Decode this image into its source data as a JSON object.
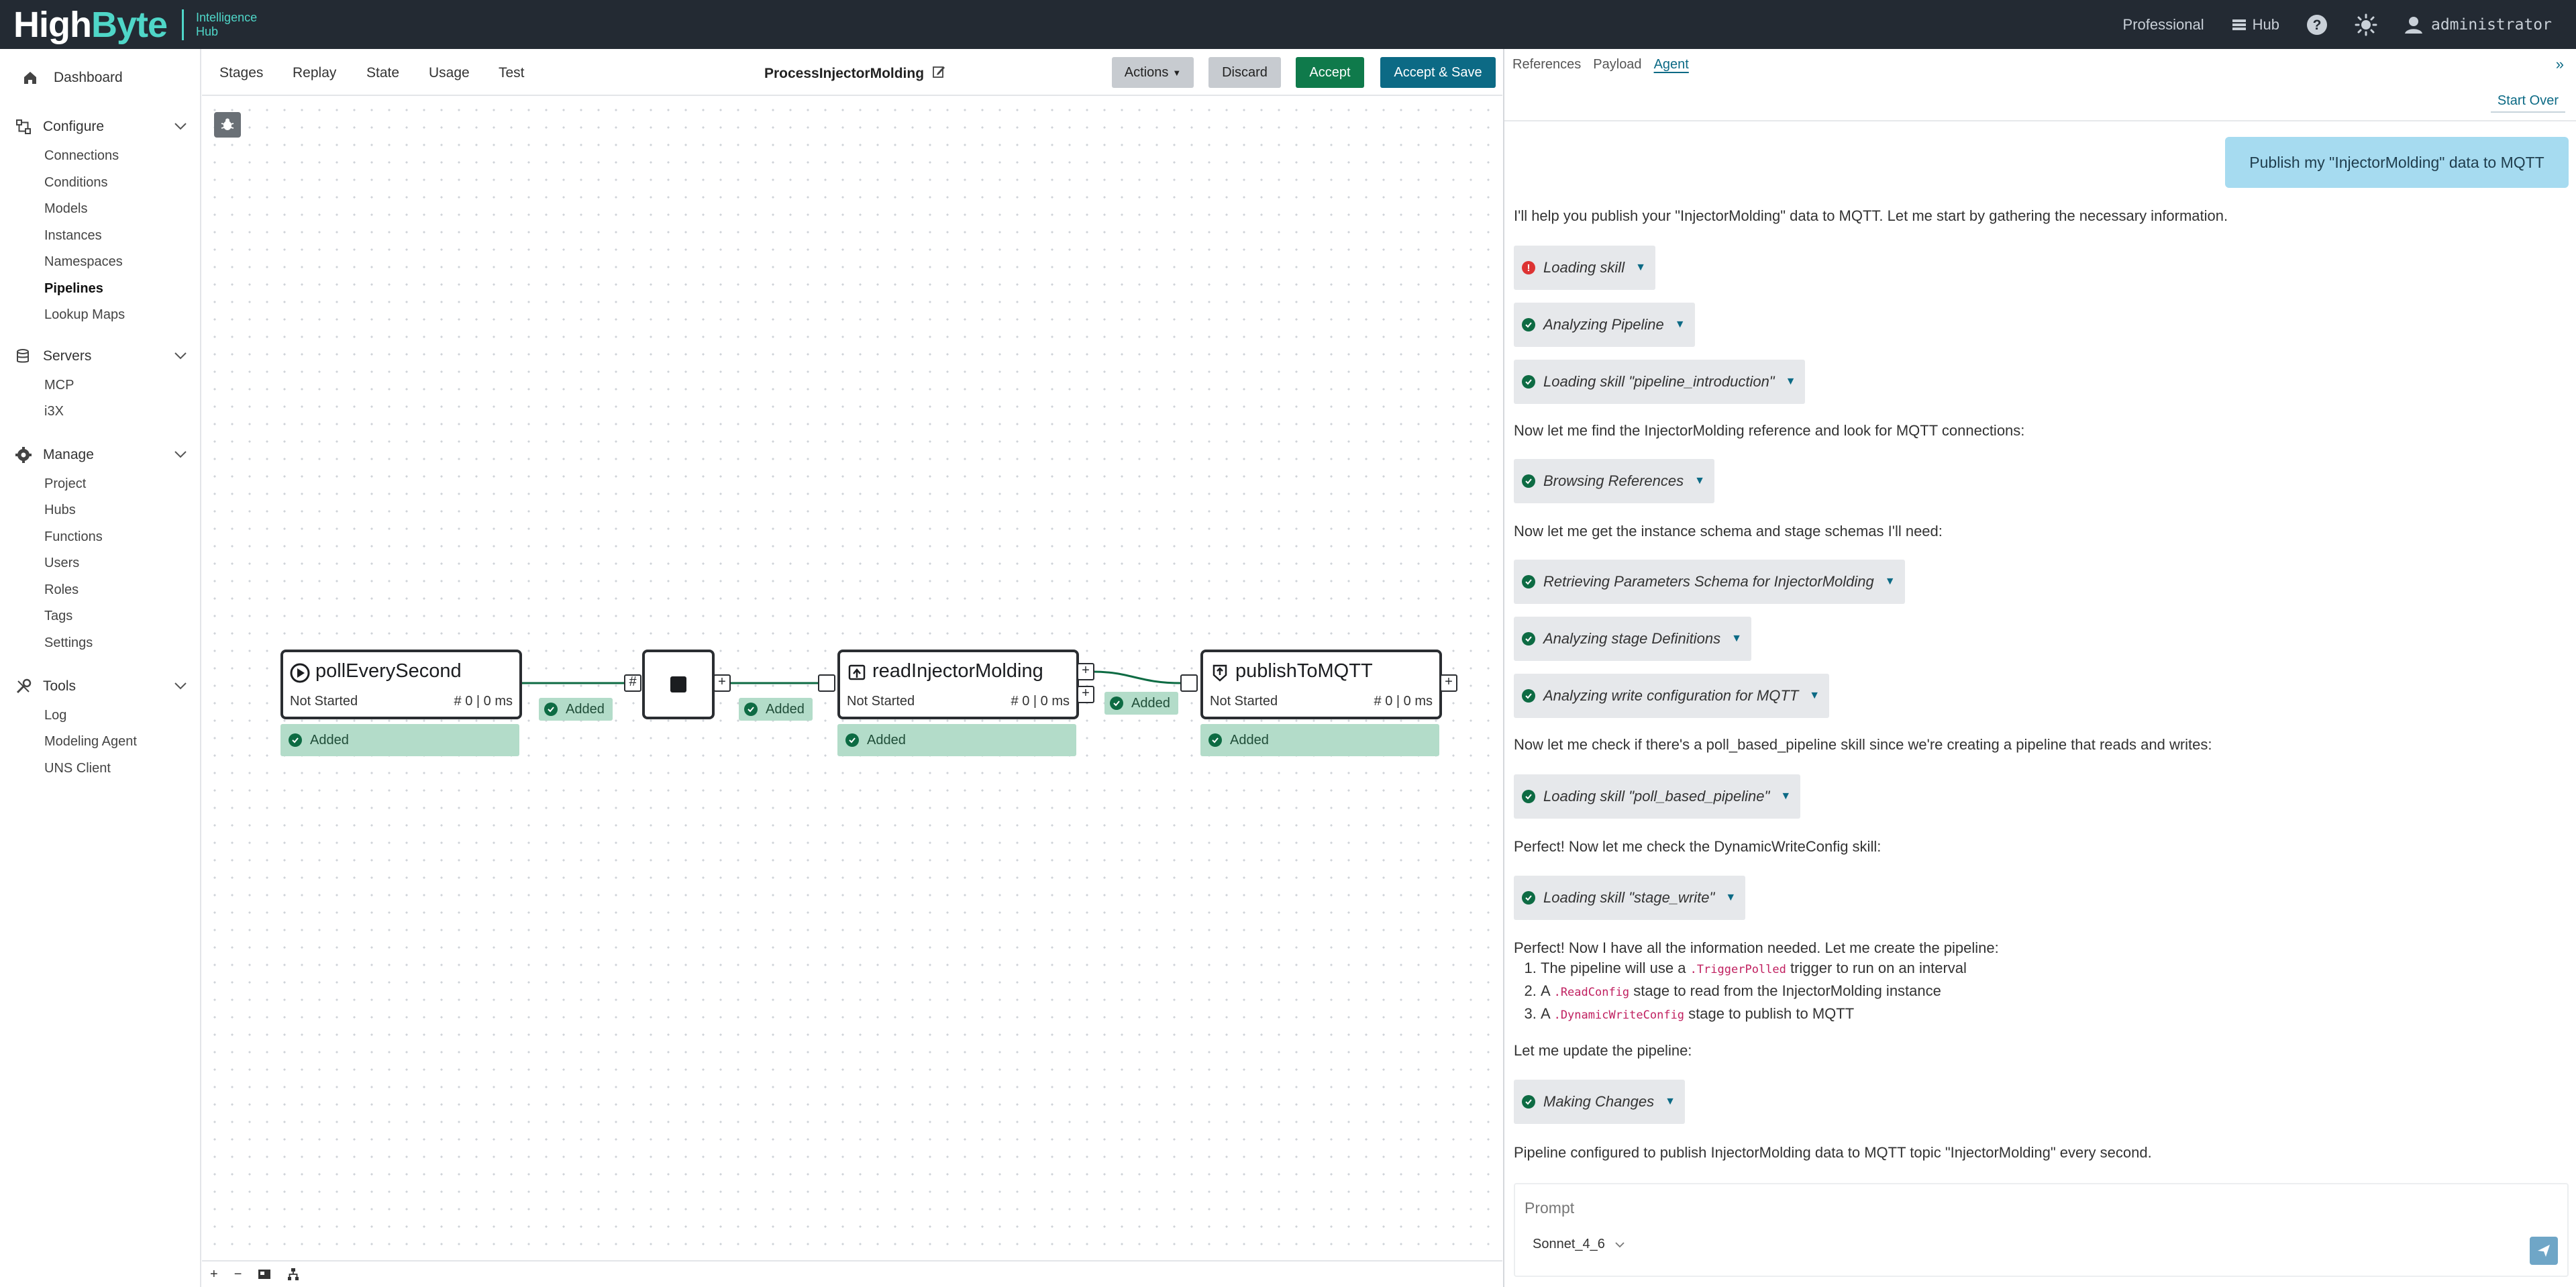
{
  "topbar": {
    "logo_main_a": "High",
    "logo_main_b": "Byte",
    "logo_sub_1": "Intelligence",
    "logo_sub_2": "Hub",
    "edition": "Professional",
    "hub_label": "Hub",
    "user": "administrator"
  },
  "sidebar": {
    "dashboard": "Dashboard",
    "groups": [
      {
        "label": "Configure",
        "items": [
          "Connections",
          "Conditions",
          "Models",
          "Instances",
          "Namespaces",
          "Pipelines",
          "Lookup Maps"
        ]
      },
      {
        "label": "Servers",
        "items": [
          "MCP",
          "i3X"
        ]
      },
      {
        "label": "Manage",
        "items": [
          "Project",
          "Hubs",
          "Functions",
          "Users",
          "Roles",
          "Tags",
          "Settings"
        ]
      },
      {
        "label": "Tools",
        "items": [
          "Log",
          "Modeling Agent",
          "UNS Client"
        ]
      }
    ],
    "active_item": "Pipelines"
  },
  "editor": {
    "tabs": [
      "Stages",
      "Replay",
      "State",
      "Usage",
      "Test"
    ],
    "pipeline_name": "ProcessInjectorMolding",
    "actions_label": "Actions",
    "discard_label": "Discard",
    "accept_label": "Accept",
    "accept_save_label": "Accept & Save",
    "footer_plus": "+",
    "footer_minus": "−"
  },
  "pipeline": {
    "nodes": [
      {
        "title": "pollEverySecond",
        "status": "Not Started",
        "count": "# 0 | 0 ms",
        "added": "Added"
      },
      {
        "title": "readInjectorMolding",
        "status": "Not Started",
        "count": "# 0 | 0 ms",
        "added": "Added"
      },
      {
        "title": "publishToMQTT",
        "status": "Not Started",
        "count": "# 0 | 0 ms",
        "added": "Added"
      }
    ],
    "edge_labels": [
      "Added",
      "Added",
      "Added"
    ],
    "port_hash": "#",
    "port_plus": "+"
  },
  "agent": {
    "tabs": [
      "References",
      "Payload",
      "Agent"
    ],
    "active_tab": "Agent",
    "start_over": "Start Over",
    "user_message": "Publish my \"InjectorMolding\" data to MQTT",
    "texts": [
      "I'll help you publish your \"InjectorMolding\" data to MQTT. Let me start by gathering the necessary information.",
      "Now let me find the InjectorMolding reference and look for MQTT connections:",
      "Now let me get the instance schema and stage schemas I'll need:",
      "Now let me check if there's a poll_based_pipeline skill since we're creating a pipeline that reads and writes:",
      "Perfect! Now let me check the DynamicWriteConfig skill:",
      "Perfect! Now I have all the information needed. Let me create the pipeline:",
      "Let me update the pipeline:",
      "Pipeline configured to publish InjectorMolding data to MQTT topic \"InjectorMolding\" every second."
    ],
    "tools": [
      "Loading skill",
      "Analyzing Pipeline",
      "Loading skill \"pipeline_introduction\"",
      "Browsing References",
      "Retrieving Parameters Schema for InjectorMolding",
      "Analyzing stage Definitions",
      "Analyzing write configuration for MQTT",
      "Loading skill \"poll_based_pipeline\"",
      "Loading skill \"stage_write\"",
      "Making Changes"
    ],
    "list": [
      {
        "pre": "The pipeline will use a ",
        "code": ".TriggerPolled",
        "post": " trigger to run on an interval"
      },
      {
        "pre": "A ",
        "code": ".ReadConfig",
        "post": " stage to read from the InjectorMolding instance"
      },
      {
        "pre": "A ",
        "code": ".DynamicWriteConfig",
        "post": " stage to publish to MQTT"
      }
    ],
    "prompt_placeholder": "Prompt",
    "model": "Sonnet_4_6"
  },
  "colors": {
    "topbar": "#232a33",
    "accent_teal": "#4fd6c8",
    "accept_green": "#0f7a4b",
    "accept_save_blue": "#0c6a85",
    "added_green": "#b3dcc9",
    "user_bubble": "#a6dbf0"
  },
  "icons": [
    "help-icon",
    "sun-icon",
    "user-icon",
    "grid-icon",
    "bug-icon",
    "play-icon",
    "stop-icon",
    "read-icon",
    "publish-icon",
    "send-icon"
  ]
}
